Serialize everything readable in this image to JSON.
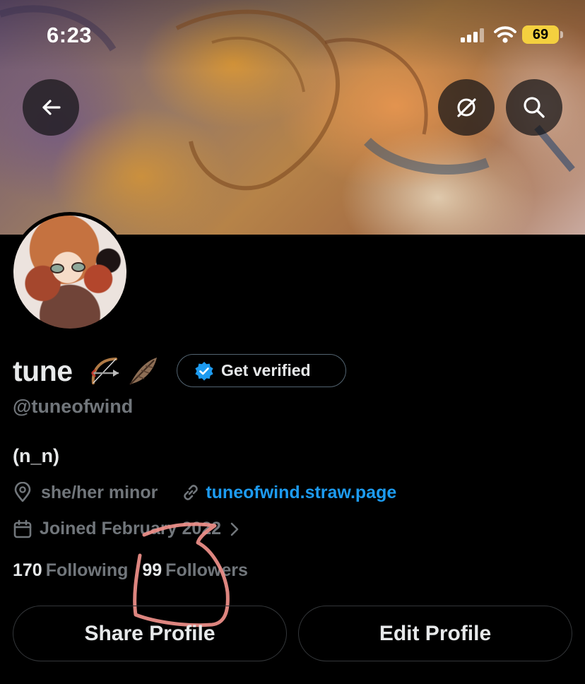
{
  "status_bar": {
    "time": "6:23",
    "battery_level": "69"
  },
  "header": {
    "icons": [
      "back-arrow-icon",
      "grok-icon",
      "search-icon"
    ]
  },
  "profile": {
    "display_name": "tune",
    "name_emojis": [
      "bow-and-arrow-emoji",
      "feather-emoji"
    ],
    "get_verified_label": "Get verified",
    "handle": "@tuneofwind",
    "bio": "(n_n)",
    "location": "she/her minor",
    "website": "tuneofwind.straw.page",
    "joined": "Joined February 2022",
    "following_count": "170",
    "following_label": "Following",
    "followers_count": "99",
    "followers_label": "Followers"
  },
  "actions": {
    "share_label": "Share Profile",
    "edit_label": "Edit Profile"
  },
  "colors": {
    "background": "#000000",
    "primary_text": "#e7e9ea",
    "secondary_text": "#71767b",
    "link": "#1d9bf0",
    "verified_badge": "#1d9bf0",
    "battery": "#f4d03f",
    "annotation_stroke": "#f0908a"
  }
}
